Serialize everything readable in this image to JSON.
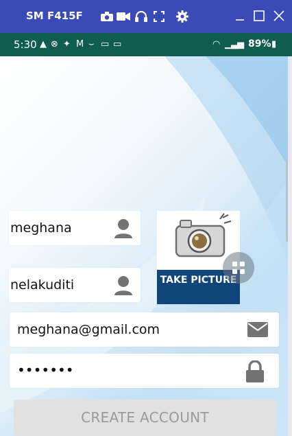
{
  "window": {
    "device_title": "SM F415F",
    "toolbar_icons": [
      "camera-icon",
      "video-icon",
      "headset-icon",
      "fullscreen-icon",
      "settings-icon"
    ],
    "controls": [
      "minimize-icon",
      "maximize-icon",
      "close-icon"
    ]
  },
  "status_bar": {
    "time": "5:30",
    "notification_icons": [
      "warning-icon",
      "navigation-icon",
      "twitter-icon",
      "gmail-icon",
      "wave-icon",
      "keyboard-icon",
      "laptop-icon"
    ],
    "battery": "89%"
  },
  "form": {
    "first_name": {
      "value": "meghana",
      "icon": "person-icon"
    },
    "last_name": {
      "value": "nelakuditi",
      "icon": "person-icon"
    },
    "email": {
      "value": "meghana@gmail.com",
      "icon": "mail-icon"
    },
    "password": {
      "value": "•••••••",
      "icon": "lock-icon"
    },
    "take_picture_label": "TAKE PICTURE",
    "create_account_label": "CREATE ACCOUNT"
  },
  "colors": {
    "titlebar": "#3a4ab6",
    "statusbar": "#0f5c50",
    "camera_caption": "#10457a"
  }
}
